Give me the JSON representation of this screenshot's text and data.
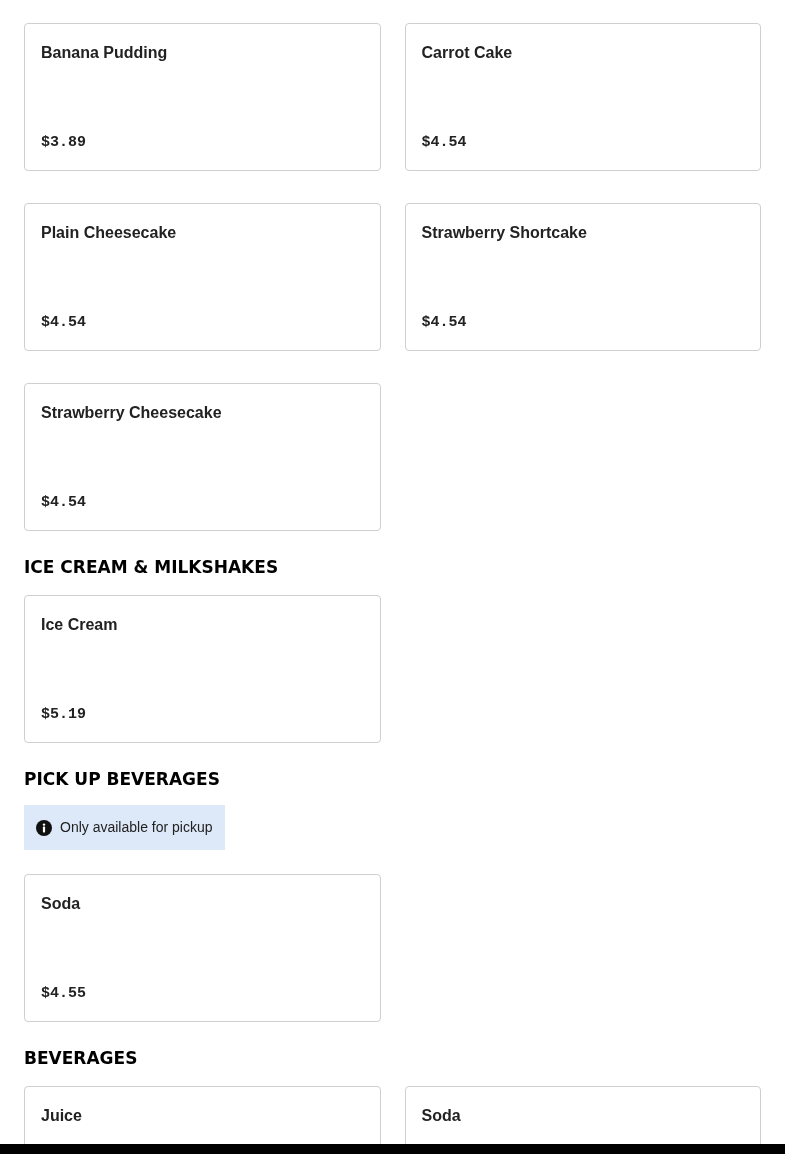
{
  "sections": [
    {
      "items": [
        {
          "name": "Banana Pudding",
          "price": "$3.89"
        },
        {
          "name": "Carrot Cake",
          "price": "$4.54"
        },
        {
          "name": "Plain Cheesecake",
          "price": "$4.54"
        },
        {
          "name": "Strawberry Shortcake",
          "price": "$4.54"
        },
        {
          "name": "Strawberry Cheesecake",
          "price": "$4.54"
        }
      ]
    },
    {
      "title": "ICE CREAM & MILKSHAKES",
      "items": [
        {
          "name": "Ice Cream",
          "price": "$5.19"
        }
      ]
    },
    {
      "title": "PICK UP BEVERAGES",
      "notice": "Only available for pickup",
      "items": [
        {
          "name": "Soda",
          "price": "$4.55"
        }
      ]
    },
    {
      "title": "BEVERAGES",
      "items": [
        {
          "name": "Juice"
        },
        {
          "name": "Soda"
        }
      ]
    }
  ]
}
